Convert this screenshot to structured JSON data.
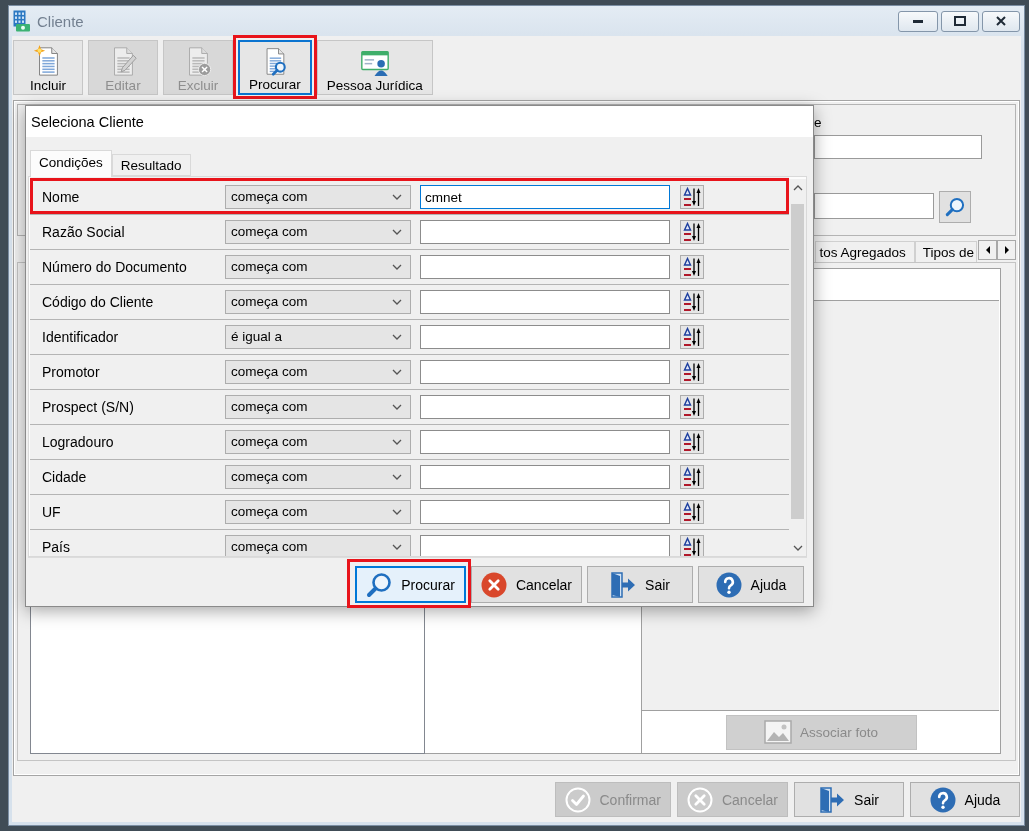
{
  "window": {
    "title": "Cliente"
  },
  "toolbar": [
    {
      "kind": "new",
      "label": "Incluir",
      "disabled": false,
      "focused": false,
      "highlighted": false
    },
    {
      "kind": "edit",
      "label": "Editar",
      "disabled": true,
      "focused": false,
      "highlighted": false
    },
    {
      "kind": "delete",
      "label": "Excluir",
      "disabled": true,
      "focused": false,
      "highlighted": false
    },
    {
      "kind": "search",
      "label": "Procurar",
      "disabled": false,
      "focused": true,
      "highlighted": true
    },
    {
      "kind": "person_card",
      "label": "Pessoa Jurídica",
      "disabled": false,
      "focused": false,
      "highlighted": false
    }
  ],
  "form": {
    "field_label": "e"
  },
  "main_tabs": [
    {
      "label": "tos Agregados",
      "selected": false
    },
    {
      "label": "Tipos de",
      "selected": false
    }
  ],
  "photo_button": {
    "label": "Associar foto",
    "disabled": true
  },
  "dialog": {
    "title": "Seleciona Cliente",
    "tabs": [
      {
        "label": "Condições",
        "selected": true
      },
      {
        "label": "Resultado",
        "selected": false
      }
    ],
    "conditions": [
      {
        "field": "Nome",
        "operator": "começa com",
        "value": "cmnet",
        "focused": true,
        "highlighted": true
      },
      {
        "field": "Razão Social",
        "operator": "começa com",
        "focused": false,
        "highlighted": false
      },
      {
        "field": "Número do Documento",
        "operator": "começa com",
        "focused": false,
        "highlighted": false
      },
      {
        "field": "Código do Cliente",
        "operator": "começa com",
        "focused": false,
        "highlighted": false
      },
      {
        "field": "Identificador",
        "operator": "é igual a",
        "focused": false,
        "highlighted": false
      },
      {
        "field": "Promotor",
        "operator": "começa com",
        "focused": false,
        "highlighted": false
      },
      {
        "field": "Prospect (S/N)",
        "operator": "começa com",
        "focused": false,
        "highlighted": false
      },
      {
        "field": "Logradouro",
        "operator": "começa com",
        "focused": false,
        "highlighted": false
      },
      {
        "field": "Cidade",
        "operator": "começa com",
        "focused": false,
        "highlighted": false
      },
      {
        "field": "UF",
        "operator": "começa com",
        "focused": false,
        "highlighted": false
      },
      {
        "field": "País",
        "operator": "começa com",
        "focused": false,
        "highlighted": false
      }
    ],
    "buttons": [
      {
        "kind": "search",
        "label": "Procurar",
        "default": true,
        "highlighted": true
      },
      {
        "kind": "cancel",
        "label": "Cancelar",
        "default": false,
        "highlighted": false
      },
      {
        "kind": "exit",
        "label": "Sair",
        "default": false,
        "highlighted": false
      },
      {
        "kind": "help",
        "label": "Ajuda",
        "default": false,
        "highlighted": false
      }
    ]
  },
  "footer_buttons": [
    {
      "kind": "confirm",
      "label": "Confirmar",
      "disabled": true
    },
    {
      "kind": "cancel",
      "label": "Cancelar",
      "disabled": true
    },
    {
      "kind": "exit",
      "label": "Sair",
      "disabled": false
    },
    {
      "kind": "help",
      "label": "Ajuda",
      "disabled": false
    }
  ]
}
